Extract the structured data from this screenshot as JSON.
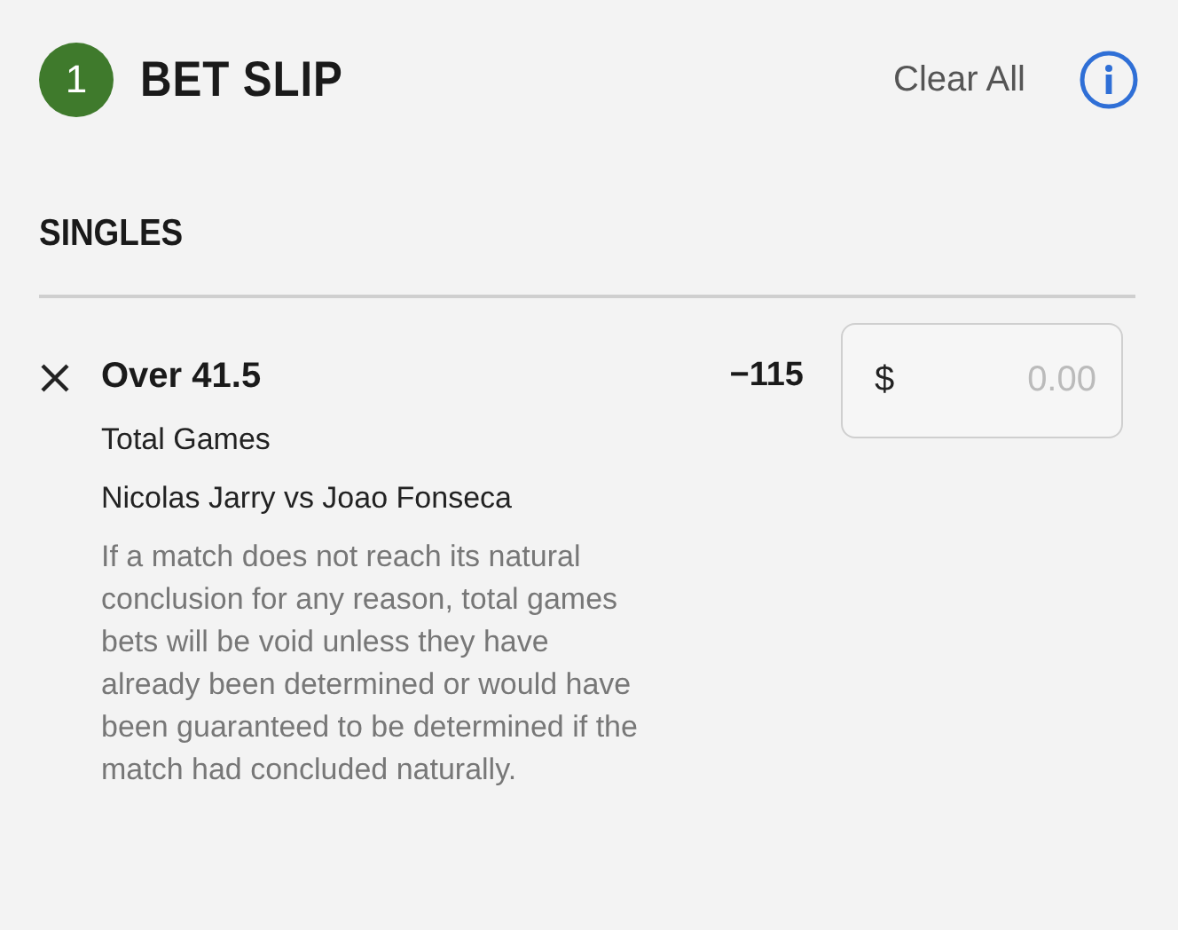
{
  "header": {
    "count": "1",
    "title": "BET SLIP",
    "clear_label": "Clear All"
  },
  "section": {
    "title": "SINGLES"
  },
  "bets": [
    {
      "selection": "Over 41.5",
      "odds": "−115",
      "market": "Total Games",
      "event": "Nicolas Jarry vs Joao Fonseca",
      "note": "If a match does not reach its natural conclusion for any reason, total games bets will be void unless they have already been determined or would have been guaranteed to be determined if the match had concluded naturally.",
      "currency": "$",
      "stake_placeholder": "0.00"
    }
  ]
}
